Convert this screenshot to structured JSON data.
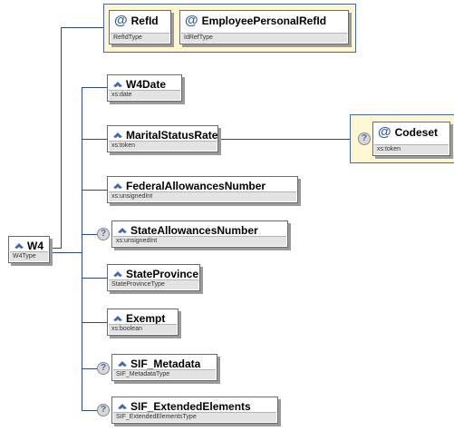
{
  "root": {
    "name": "W4",
    "type": "W4Type"
  },
  "attributes": [
    {
      "name": "RefId",
      "type": "RefIdType"
    },
    {
      "name": "EmployeePersonalRefId",
      "type": "IdRefType"
    }
  ],
  "children": [
    {
      "name": "W4Date",
      "type": "xs:date",
      "optional": false
    },
    {
      "name": "MaritalStatusRate",
      "type": "xs:token",
      "optional": false
    },
    {
      "name": "FederalAllowancesNumber",
      "type": "xs:unsignedInt",
      "optional": false
    },
    {
      "name": "StateAllowancesNumber",
      "type": "xs:unsignedInt",
      "optional": true
    },
    {
      "name": "StateProvince",
      "type": "StateProvinceType",
      "optional": false
    },
    {
      "name": "Exempt",
      "type": "xs:boolean",
      "optional": false
    },
    {
      "name": "SIF_Metadata",
      "type": "SIF_MetadataType",
      "optional": true
    },
    {
      "name": "SIF_ExtendedElements",
      "type": "SIF_ExtendedElementsType",
      "optional": true
    }
  ],
  "marital_attribute": {
    "name": "Codeset",
    "type": "xs:token",
    "optional": true
  },
  "icons": {
    "element": "element-diamond-icon",
    "attribute": "at-sign-icon",
    "optional": "question-mark-icon"
  },
  "colors": {
    "connector": "#2f4b86",
    "attribute_group_fill": "#fff6d2",
    "type_bar": "#e3e3e3",
    "attribute_symbol": "#2f5da8"
  }
}
